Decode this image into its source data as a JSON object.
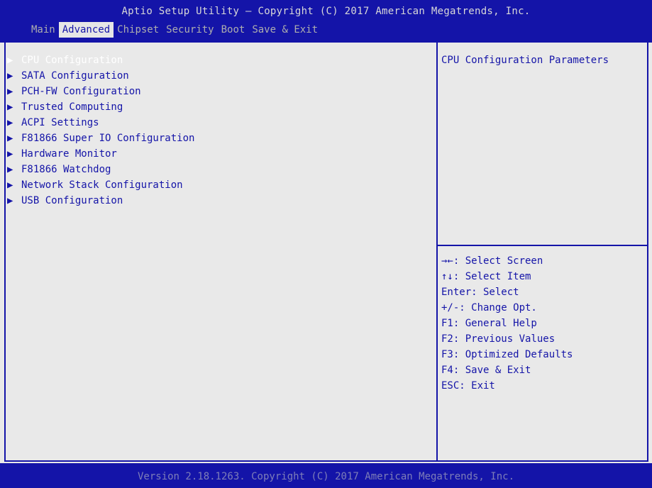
{
  "header": {
    "title": "Aptio Setup Utility – Copyright (C) 2017 American Megatrends, Inc.",
    "tabs": [
      {
        "label": "Main"
      },
      {
        "label": "Advanced"
      },
      {
        "label": "Chipset"
      },
      {
        "label": "Security"
      },
      {
        "label": "Boot"
      },
      {
        "label": "Save & Exit"
      }
    ],
    "active_tab": "Advanced"
  },
  "menu": {
    "arrow_glyph": "▶",
    "items": [
      {
        "label": "CPU Configuration"
      },
      {
        "label": "SATA Configuration"
      },
      {
        "label": "PCH-FW Configuration"
      },
      {
        "label": "Trusted Computing"
      },
      {
        "label": "ACPI Settings"
      },
      {
        "label": "F81866 Super IO Configuration"
      },
      {
        "label": "Hardware Monitor"
      },
      {
        "label": "F81866 Watchdog"
      },
      {
        "label": "Network Stack Configuration"
      },
      {
        "label": "USB Configuration"
      }
    ],
    "selected": "CPU Configuration"
  },
  "help": {
    "text": "CPU Configuration Parameters"
  },
  "keys": [
    {
      "text": "→←: Select Screen"
    },
    {
      "text": "↑↓: Select Item"
    },
    {
      "text": "Enter: Select"
    },
    {
      "text": "+/-: Change Opt."
    },
    {
      "text": "F1: General Help"
    },
    {
      "text": "F2: Previous Values"
    },
    {
      "text": "F3: Optimized Defaults"
    },
    {
      "text": "F4: Save & Exit"
    },
    {
      "text": "ESC: Exit"
    }
  ],
  "footer": {
    "text": "Version 2.18.1263. Copyright (C) 2017 American Megatrends, Inc."
  },
  "colors": {
    "bios_blue": "#1414a8",
    "background": "#e9e9e9",
    "highlight_text": "#ffffff"
  }
}
